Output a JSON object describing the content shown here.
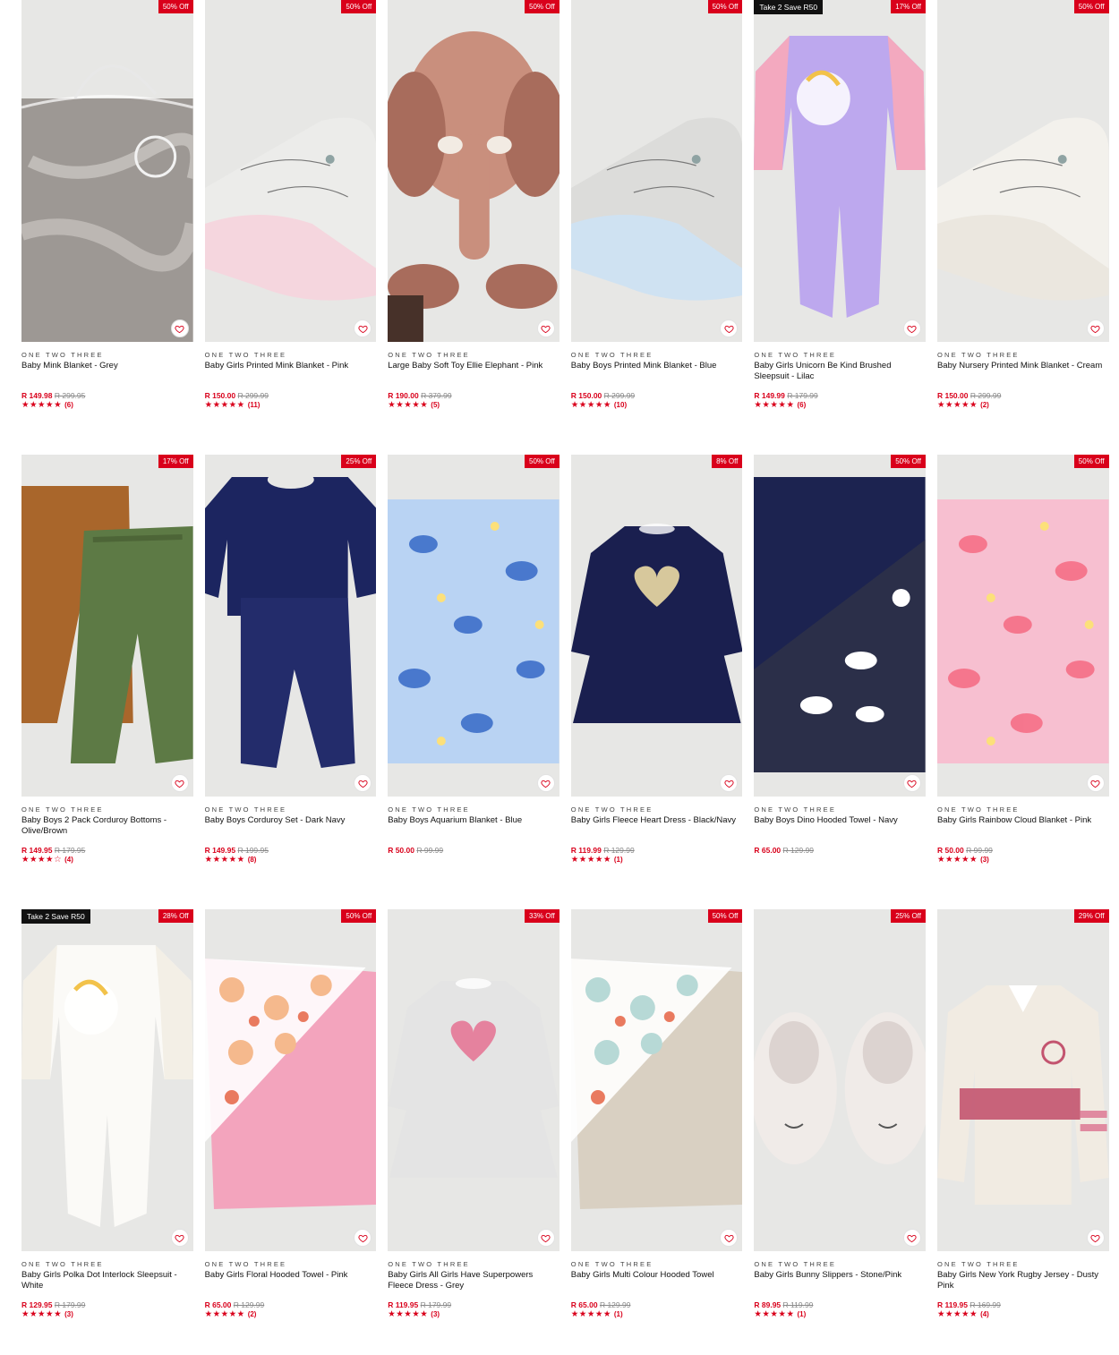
{
  "products": [
    {
      "brand": "ONE TWO THREE",
      "title": "Baby Mink Blanket - Grey",
      "price": "R 149.98",
      "was": "R 299.95",
      "badge": "50% Off",
      "promo": "",
      "stars": "★★★★★",
      "count": "(6)",
      "art": "bag-blanket",
      "c1": "#9d9894",
      "c2": "#c9c5c0"
    },
    {
      "brand": "ONE TWO THREE",
      "title": "Baby Girls Printed Mink Blanket - Pink",
      "price": "R 150.00",
      "was": "R 299.99",
      "badge": "50% Off",
      "promo": "",
      "stars": "★★★★★",
      "count": "(11)",
      "art": "folded",
      "c1": "#ececea",
      "c2": "#f5d6de"
    },
    {
      "brand": "ONE TWO THREE",
      "title": "Large Baby Soft Toy Ellie Elephant - Pink",
      "price": "R 190.00",
      "was": "R 379.99",
      "badge": "50% Off",
      "promo": "",
      "stars": "★★★★★",
      "count": "(5)",
      "art": "elephant",
      "c1": "#c98f7d",
      "c2": "#a86c5c"
    },
    {
      "brand": "ONE TWO THREE",
      "title": "Baby Boys Printed Mink Blanket - Blue",
      "price": "R 150.00",
      "was": "R 299.99",
      "badge": "50% Off",
      "promo": "",
      "stars": "★★★★★",
      "count": "(10)",
      "art": "folded",
      "c1": "#dcdcda",
      "c2": "#cfe2f2"
    },
    {
      "brand": "ONE TWO THREE",
      "title": "Baby Girls Unicorn Be Kind Brushed Sleepsuit - Lilac",
      "price": "R 149.99",
      "was": "R 179.99",
      "badge": "17% Off",
      "promo": "Take 2 Save R50",
      "stars": "★★★★★",
      "count": "(6)",
      "art": "sleepsuit",
      "c1": "#bda8ee",
      "c2": "#f3a9bf"
    },
    {
      "brand": "ONE TWO THREE",
      "title": "Baby Nursery Printed Mink Blanket - Cream",
      "price": "R 150.00",
      "was": "R 299.99",
      "badge": "50% Off",
      "promo": "",
      "stars": "★★★★★",
      "count": "(2)",
      "art": "folded",
      "c1": "#f3f1ec",
      "c2": "#ebe7df"
    },
    {
      "brand": "ONE TWO THREE",
      "title": "Baby Boys 2 Pack Corduroy Bottoms - Olive/Brown",
      "price": "R 149.95",
      "was": "R 179.95",
      "badge": "17% Off",
      "promo": "",
      "stars": "★★★★☆",
      "count": "(4)",
      "art": "pants",
      "c1": "#a9662b",
      "c2": "#5d7a45"
    },
    {
      "brand": "ONE TWO THREE",
      "title": "Baby Boys Corduroy Set - Dark Navy",
      "price": "R 149.95",
      "was": "R 199.95",
      "badge": "25% Off",
      "promo": "",
      "stars": "★★★★★",
      "count": "(8)",
      "art": "set",
      "c1": "#1c2560",
      "c2": "#232c6b"
    },
    {
      "brand": "ONE TWO THREE",
      "title": "Baby Boys Aquarium Blanket - Blue",
      "price": "R 50.00",
      "was": "R 99.99",
      "badge": "50% Off",
      "promo": "",
      "stars": "",
      "count": "",
      "art": "flat",
      "c1": "#b9d3f3",
      "c2": "#3d6fc9"
    },
    {
      "brand": "ONE TWO THREE",
      "title": "Baby Girls Fleece Heart Dress - Black/Navy",
      "price": "R 119.99",
      "was": "R 129.99",
      "badge": "8% Off",
      "promo": "",
      "stars": "★★★★★",
      "count": "(1)",
      "art": "dress",
      "c1": "#1a1f4f",
      "c2": "#d7c89c"
    },
    {
      "brand": "ONE TWO THREE",
      "title": "Baby Boys Dino Hooded Towel - Navy",
      "price": "R 65.00",
      "was": "R 129.99",
      "badge": "50% Off",
      "promo": "",
      "stars": "",
      "count": "",
      "art": "towel-dark",
      "c1": "#1c2350",
      "c2": "#2b2f49"
    },
    {
      "brand": "ONE TWO THREE",
      "title": "Baby Girls Rainbow Cloud Blanket - Pink",
      "price": "R 50.00",
      "was": "R 99.99",
      "badge": "50% Off",
      "promo": "",
      "stars": "★★★★★",
      "count": "(3)",
      "art": "flat",
      "c1": "#f7bfd0",
      "c2": "#f56f86"
    },
    {
      "brand": "ONE TWO THREE",
      "title": "Baby Girls Polka Dot Interlock Sleepsuit - White",
      "price": "R 129.95",
      "was": "R 179.99",
      "badge": "28% Off",
      "promo": "Take 2 Save R50",
      "stars": "★★★★★",
      "count": "(3)",
      "art": "sleepsuit",
      "c1": "#fbfaf7",
      "c2": "#f3efe6"
    },
    {
      "brand": "ONE TWO THREE",
      "title": "Baby Girls Floral Hooded Towel - Pink",
      "price": "R 65.00",
      "was": "R 129.99",
      "badge": "50% Off",
      "promo": "",
      "stars": "★★★★★",
      "count": "(2)",
      "art": "towel",
      "c1": "#f3a4bd",
      "c2": "#f5b98d"
    },
    {
      "brand": "ONE TWO THREE",
      "title": "Baby Girls All Girls Have Superpowers Fleece Dress - Grey",
      "price": "R 119.95",
      "was": "R 179.99",
      "badge": "33% Off",
      "promo": "",
      "stars": "★★★★★",
      "count": "(3)",
      "art": "dress",
      "c1": "#e4e4e4",
      "c2": "#e5829e"
    },
    {
      "brand": "ONE TWO THREE",
      "title": "Baby Girls Multi Colour Hooded Towel",
      "price": "R 65.00",
      "was": "R 129.99",
      "badge": "50% Off",
      "promo": "",
      "stars": "★★★★★",
      "count": "(1)",
      "art": "towel",
      "c1": "#d9d0c2",
      "c2": "#b7d9d6"
    },
    {
      "brand": "ONE TWO THREE",
      "title": "Baby Girls Bunny Slippers - Stone/Pink",
      "price": "R 89.95",
      "was": "R 119.99",
      "badge": "25% Off",
      "promo": "",
      "stars": "★★★★★",
      "count": "(1)",
      "art": "slippers",
      "c1": "#f0ebe8",
      "c2": "#dcd3d0"
    },
    {
      "brand": "ONE TWO THREE",
      "title": "Baby Girls New York Rugby Jersey - Dusty Pink",
      "price": "R 119.95",
      "was": "R 169.99",
      "badge": "29% Off",
      "promo": "",
      "stars": "★★★★★",
      "count": "(4)",
      "art": "jersey",
      "c1": "#f1ebe2",
      "c2": "#c3546f"
    }
  ],
  "icons": {
    "wishlist": "heart-outline-icon"
  },
  "colors": {
    "accent": "#d9001b",
    "promo": "#111111"
  }
}
